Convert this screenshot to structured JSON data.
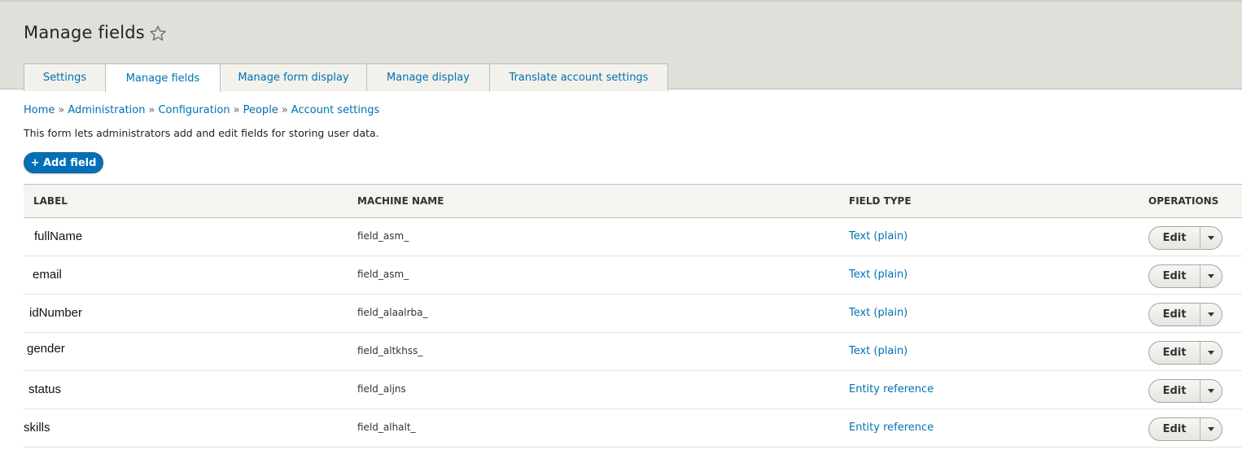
{
  "header": {
    "title": "Manage fields",
    "star_icon": "star-outline-icon"
  },
  "tabs": [
    {
      "label": "Settings",
      "active": false
    },
    {
      "label": "Manage fields",
      "active": true
    },
    {
      "label": "Manage form display",
      "active": false
    },
    {
      "label": "Manage display",
      "active": false
    },
    {
      "label": "Translate account settings",
      "active": false
    }
  ],
  "breadcrumb": [
    "Home",
    "Administration",
    "Configuration",
    "People",
    "Account settings"
  ],
  "breadcrumb_separator": "»",
  "description": "This form lets administrators add and edit fields for storing user data.",
  "add_field_label": "+ Add field",
  "table": {
    "headers": {
      "label": "LABEL",
      "machine_name": "MACHINE NAME",
      "field_type": "FIELD TYPE",
      "operations": "OPERATIONS"
    },
    "rows": [
      {
        "label": "fullName",
        "machine_name": "field_asm_",
        "field_type": "Text (plain)",
        "edit": "Edit"
      },
      {
        "label": "email",
        "machine_name": "field_asm_",
        "field_type": "Text (plain)",
        "edit": "Edit"
      },
      {
        "label": "idNumber",
        "machine_name": "field_alaalrba_",
        "field_type": "Text (plain)",
        "edit": "Edit"
      },
      {
        "label": "gender",
        "machine_name": "field_altkhss_",
        "field_type": "Text (plain)",
        "edit": "Edit"
      },
      {
        "label": "status",
        "machine_name": "field_aljns",
        "field_type": "Entity reference",
        "edit": "Edit"
      },
      {
        "label": "skills",
        "machine_name": "field_alhalt_",
        "field_type": "Entity reference",
        "edit": "Edit"
      }
    ]
  },
  "colors": {
    "header_bg": "#e0dfd9",
    "link": "#0071b3",
    "primary_button": "#0071b8"
  }
}
